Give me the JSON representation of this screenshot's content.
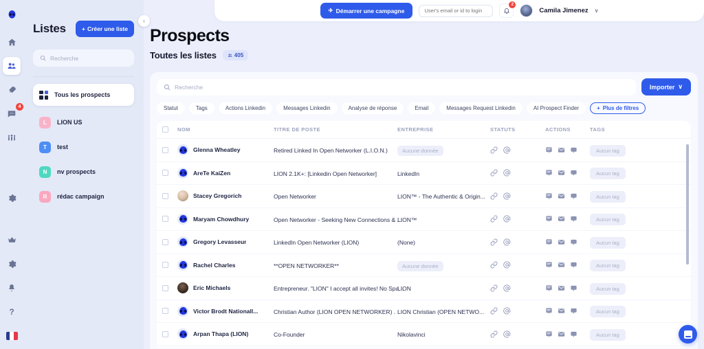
{
  "rail": {
    "items": [
      {
        "name": "logo",
        "glyph": "●",
        "badge": ""
      },
      {
        "name": "home",
        "glyph": "⌂",
        "badge": ""
      },
      {
        "name": "prospects",
        "glyph": "👥",
        "badge": ""
      },
      {
        "name": "campaigns",
        "glyph": "➤",
        "badge": ""
      },
      {
        "name": "messages",
        "glyph": "💬",
        "badge": "4"
      },
      {
        "name": "teams",
        "glyph": "☷",
        "badge": ""
      },
      {
        "name": "settings-mid",
        "glyph": "⚙",
        "badge": ""
      }
    ],
    "bottom": [
      {
        "name": "premium",
        "glyph": "♛"
      },
      {
        "name": "settings",
        "glyph": "⚙"
      },
      {
        "name": "notifications",
        "glyph": "🔔"
      },
      {
        "name": "help",
        "glyph": "?"
      }
    ],
    "language": "fr"
  },
  "sidebar": {
    "title": "Listes",
    "create_label": "Créer une liste",
    "create_icon": "+",
    "search_placeholder": "Recherche",
    "all_prospects": "Tous les prospects",
    "items": [
      {
        "initial": "L",
        "label": "LION US",
        "color": "#f9b3c9"
      },
      {
        "initial": "T",
        "label": "test",
        "color": "#4d8ef7"
      },
      {
        "initial": "N",
        "label": "nv prospects",
        "color": "#4ed8c0"
      },
      {
        "initial": "R",
        "label": "rédac campaign",
        "color": "#f9a8c0"
      }
    ],
    "collapse_icon": "‹"
  },
  "topbar": {
    "campaign_label": "Démarrer une campagne",
    "campaign_icon": "✈",
    "login_placeholder": "User's email or id to login",
    "login_value": "",
    "bell_badge": "2",
    "user_name": "Camila Jimenez",
    "caret": "∨"
  },
  "page": {
    "title": "Prospects",
    "subtitle": "Toutes les listes",
    "count": "405",
    "count_icon": "◈"
  },
  "toolbar": {
    "search_placeholder": "Recherche",
    "import_label": "Importer",
    "import_caret": "∨",
    "filters": [
      "Statut",
      "Tags",
      "Actions Linkedin",
      "Messages Linkedin",
      "Analyse de réponse",
      "Email",
      "Messages Request Linkedin",
      "AI Prospect Finder"
    ],
    "more_filters": "Plus de filtres",
    "more_filters_icon": "+"
  },
  "table": {
    "columns": [
      "NOM",
      "TITRE DE POSTE",
      "ENTREPRISE",
      "STATUTS",
      "ACTIONS",
      "TAGS"
    ],
    "empty_label": "Aucune donnée",
    "no_tag_label": "Aucun tag",
    "status_icons": [
      "link-icon",
      "at-icon"
    ],
    "action_icons": [
      "note-icon",
      "envelope-icon",
      "chat-icon"
    ],
    "rows": [
      {
        "avatar": "alien",
        "name": "Glenna Wheatley",
        "title": "Retired Linked In Open Networker (L.I.O.N.)",
        "company": "Aucune donnée",
        "company_empty": true,
        "tag": "Aucun tag"
      },
      {
        "avatar": "alien",
        "name": "AreTe KaiZen",
        "title": "LION 2.1K+: [Linkedin Open Networker]",
        "company": "LinkedIn",
        "company_empty": false,
        "tag": "Aucun tag"
      },
      {
        "avatar": "photo1",
        "name": "Stacey Gregorich",
        "title": "Open Networker",
        "company": "LION™ - The Authentic & Origin...",
        "company_empty": false,
        "tag": "Aucun tag"
      },
      {
        "avatar": "alien",
        "name": "Maryam Chowdhury",
        "title": "Open Networker - Seeking New Connections & ...",
        "company": "LION™",
        "company_empty": false,
        "tag": "Aucun tag"
      },
      {
        "avatar": "alien",
        "name": "Gregory Levasseur",
        "title": "LinkedIn Open Networker (LION)",
        "company": "(None)",
        "company_empty": false,
        "tag": "Aucun tag"
      },
      {
        "avatar": "alien",
        "name": "Rachel Charles",
        "title": "**OPEN NETWORKER**",
        "company": "Aucune donnée",
        "company_empty": true,
        "tag": "Aucun tag"
      },
      {
        "avatar": "photo2",
        "name": "Eric Michaels",
        "title": "Entrepreneur. \"LION\" I accept all invites! No Spa...",
        "company": "LION",
        "company_empty": false,
        "tag": "Aucun tag"
      },
      {
        "avatar": "alien",
        "name": "Victor Brodt Nationall...",
        "title": "Christian Author (LION OPEN NETWORKER) .",
        "company": "LION Christian (OPEN NETWO...",
        "company_empty": false,
        "tag": "Aucun tag"
      },
      {
        "avatar": "alien",
        "name": "Arpan Thapa (LION)",
        "title": "Co-Founder",
        "company": "Nikolavinci",
        "company_empty": false,
        "tag": "Aucun tag"
      }
    ]
  },
  "colors": {
    "accent": "#2f5bea",
    "badge_red": "#f2443c",
    "page_bg": "#eceffb"
  }
}
